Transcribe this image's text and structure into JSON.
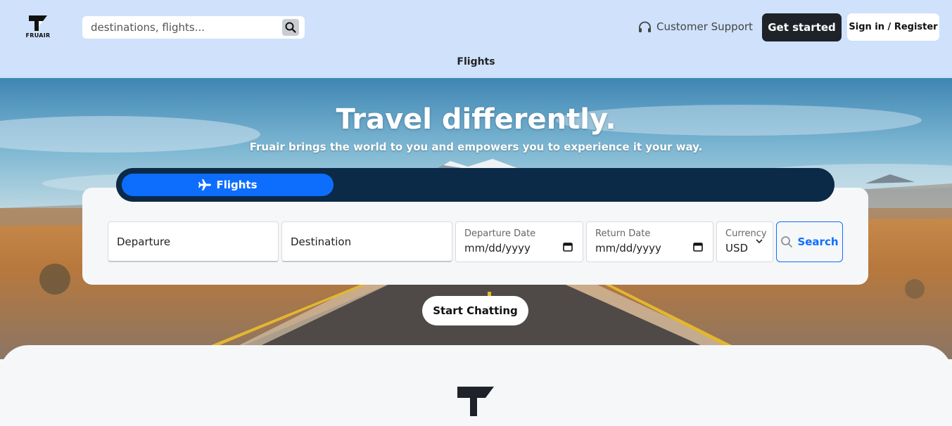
{
  "header": {
    "logo_text": "FRUAIR",
    "search": {
      "placeholder": "destinations, flights..."
    },
    "support_label": "Customer Support",
    "get_started_label": "Get started",
    "sign_in_label": "Sign in / Register",
    "nav": [
      {
        "label": "Flights"
      }
    ]
  },
  "hero": {
    "title": "Travel differently.",
    "subtitle": "Fruair brings the world to you and empowers you to experience it your way.",
    "tabs": [
      {
        "label": "Flights",
        "icon": "plane-icon",
        "active": true
      }
    ],
    "form": {
      "departure": "Departure",
      "destination": "Destination",
      "departure_date_label": "Departure Date",
      "departure_date_value": "mm/dd/yyyy",
      "return_date_label": "Return Date",
      "return_date_value": "mm/dd/yyyy",
      "currency_label": "Currency",
      "currency_value": "USD",
      "search_label": "Search"
    },
    "chat_label": "Start Chatting"
  },
  "colors": {
    "header_bg": "#cfe1fb",
    "primary": "#0d6efd",
    "dark": "#1f2329",
    "tabbar": "#0b2a47"
  }
}
